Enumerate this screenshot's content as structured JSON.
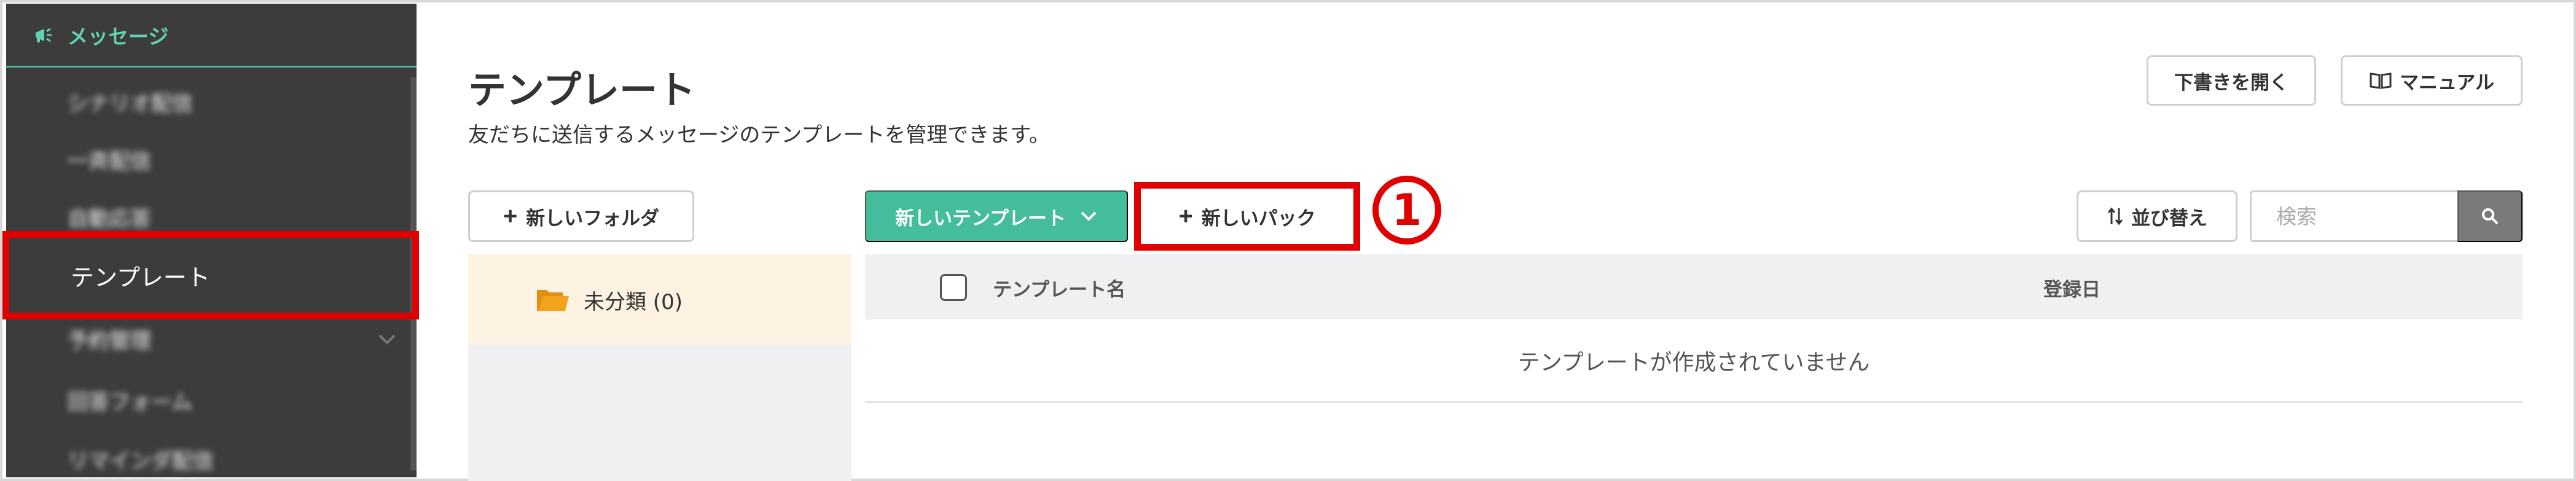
{
  "sidebar": {
    "section_title": "メッセージ",
    "items": [
      {
        "label": "シナリオ配信"
      },
      {
        "label": "一斉配信"
      },
      {
        "label": "自動応答"
      },
      {
        "label": "テンプレート"
      },
      {
        "label": "予約管理"
      },
      {
        "label": "回答フォーム"
      },
      {
        "label": "リマインダ配信"
      }
    ]
  },
  "header": {
    "title": "テンプレート",
    "description": "友だちに送信するメッセージのテンプレートを管理できます。",
    "draft_button": "下書きを開く",
    "manual_button": "マニュアル"
  },
  "toolbar": {
    "new_folder": "新しいフォルダ",
    "new_template": "新しいテンプレート",
    "new_pack": "新しいパック",
    "annotation": "①",
    "sort": "並び替え",
    "search_placeholder": "検索"
  },
  "folders": [
    {
      "label": "未分類 (0)"
    }
  ],
  "table": {
    "columns": [
      "テンプレート名",
      "登録日"
    ],
    "empty_message": "テンプレートが作成されていません"
  },
  "colors": {
    "sidebar_bg": "#3c3c3c",
    "accent_green": "#43bd9c",
    "highlight_red": "#e00000",
    "folder_selected_bg": "#fef3e3"
  }
}
